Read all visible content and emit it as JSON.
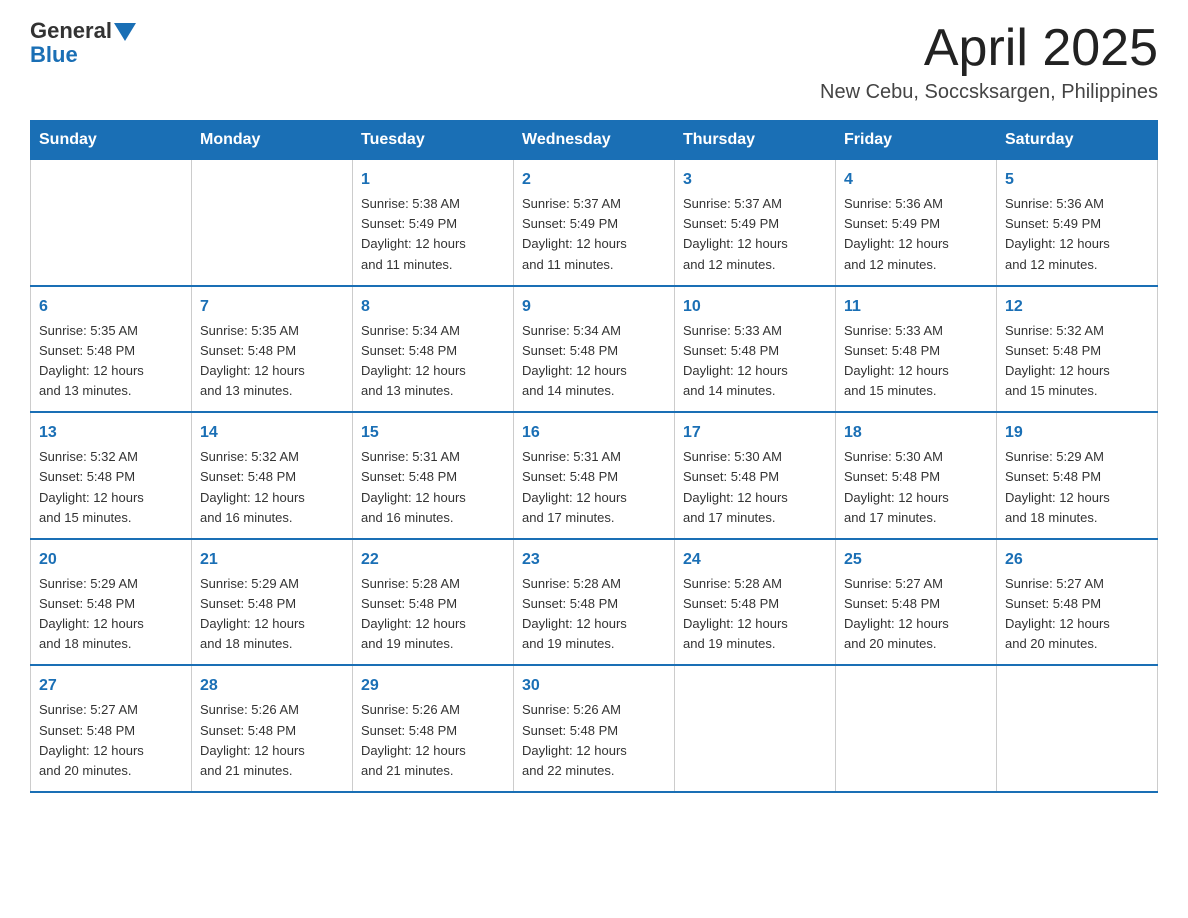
{
  "logo": {
    "general": "General",
    "blue": "Blue",
    "arrow": "▼"
  },
  "title": "April 2025",
  "subtitle": "New Cebu, Soccsksargen, Philippines",
  "days_header": [
    "Sunday",
    "Monday",
    "Tuesday",
    "Wednesday",
    "Thursday",
    "Friday",
    "Saturday"
  ],
  "weeks": [
    [
      {
        "day": "",
        "info": ""
      },
      {
        "day": "",
        "info": ""
      },
      {
        "day": "1",
        "info": "Sunrise: 5:38 AM\nSunset: 5:49 PM\nDaylight: 12 hours\nand 11 minutes."
      },
      {
        "day": "2",
        "info": "Sunrise: 5:37 AM\nSunset: 5:49 PM\nDaylight: 12 hours\nand 11 minutes."
      },
      {
        "day": "3",
        "info": "Sunrise: 5:37 AM\nSunset: 5:49 PM\nDaylight: 12 hours\nand 12 minutes."
      },
      {
        "day": "4",
        "info": "Sunrise: 5:36 AM\nSunset: 5:49 PM\nDaylight: 12 hours\nand 12 minutes."
      },
      {
        "day": "5",
        "info": "Sunrise: 5:36 AM\nSunset: 5:49 PM\nDaylight: 12 hours\nand 12 minutes."
      }
    ],
    [
      {
        "day": "6",
        "info": "Sunrise: 5:35 AM\nSunset: 5:48 PM\nDaylight: 12 hours\nand 13 minutes."
      },
      {
        "day": "7",
        "info": "Sunrise: 5:35 AM\nSunset: 5:48 PM\nDaylight: 12 hours\nand 13 minutes."
      },
      {
        "day": "8",
        "info": "Sunrise: 5:34 AM\nSunset: 5:48 PM\nDaylight: 12 hours\nand 13 minutes."
      },
      {
        "day": "9",
        "info": "Sunrise: 5:34 AM\nSunset: 5:48 PM\nDaylight: 12 hours\nand 14 minutes."
      },
      {
        "day": "10",
        "info": "Sunrise: 5:33 AM\nSunset: 5:48 PM\nDaylight: 12 hours\nand 14 minutes."
      },
      {
        "day": "11",
        "info": "Sunrise: 5:33 AM\nSunset: 5:48 PM\nDaylight: 12 hours\nand 15 minutes."
      },
      {
        "day": "12",
        "info": "Sunrise: 5:32 AM\nSunset: 5:48 PM\nDaylight: 12 hours\nand 15 minutes."
      }
    ],
    [
      {
        "day": "13",
        "info": "Sunrise: 5:32 AM\nSunset: 5:48 PM\nDaylight: 12 hours\nand 15 minutes."
      },
      {
        "day": "14",
        "info": "Sunrise: 5:32 AM\nSunset: 5:48 PM\nDaylight: 12 hours\nand 16 minutes."
      },
      {
        "day": "15",
        "info": "Sunrise: 5:31 AM\nSunset: 5:48 PM\nDaylight: 12 hours\nand 16 minutes."
      },
      {
        "day": "16",
        "info": "Sunrise: 5:31 AM\nSunset: 5:48 PM\nDaylight: 12 hours\nand 17 minutes."
      },
      {
        "day": "17",
        "info": "Sunrise: 5:30 AM\nSunset: 5:48 PM\nDaylight: 12 hours\nand 17 minutes."
      },
      {
        "day": "18",
        "info": "Sunrise: 5:30 AM\nSunset: 5:48 PM\nDaylight: 12 hours\nand 17 minutes."
      },
      {
        "day": "19",
        "info": "Sunrise: 5:29 AM\nSunset: 5:48 PM\nDaylight: 12 hours\nand 18 minutes."
      }
    ],
    [
      {
        "day": "20",
        "info": "Sunrise: 5:29 AM\nSunset: 5:48 PM\nDaylight: 12 hours\nand 18 minutes."
      },
      {
        "day": "21",
        "info": "Sunrise: 5:29 AM\nSunset: 5:48 PM\nDaylight: 12 hours\nand 18 minutes."
      },
      {
        "day": "22",
        "info": "Sunrise: 5:28 AM\nSunset: 5:48 PM\nDaylight: 12 hours\nand 19 minutes."
      },
      {
        "day": "23",
        "info": "Sunrise: 5:28 AM\nSunset: 5:48 PM\nDaylight: 12 hours\nand 19 minutes."
      },
      {
        "day": "24",
        "info": "Sunrise: 5:28 AM\nSunset: 5:48 PM\nDaylight: 12 hours\nand 19 minutes."
      },
      {
        "day": "25",
        "info": "Sunrise: 5:27 AM\nSunset: 5:48 PM\nDaylight: 12 hours\nand 20 minutes."
      },
      {
        "day": "26",
        "info": "Sunrise: 5:27 AM\nSunset: 5:48 PM\nDaylight: 12 hours\nand 20 minutes."
      }
    ],
    [
      {
        "day": "27",
        "info": "Sunrise: 5:27 AM\nSunset: 5:48 PM\nDaylight: 12 hours\nand 20 minutes."
      },
      {
        "day": "28",
        "info": "Sunrise: 5:26 AM\nSunset: 5:48 PM\nDaylight: 12 hours\nand 21 minutes."
      },
      {
        "day": "29",
        "info": "Sunrise: 5:26 AM\nSunset: 5:48 PM\nDaylight: 12 hours\nand 21 minutes."
      },
      {
        "day": "30",
        "info": "Sunrise: 5:26 AM\nSunset: 5:48 PM\nDaylight: 12 hours\nand 22 minutes."
      },
      {
        "day": "",
        "info": ""
      },
      {
        "day": "",
        "info": ""
      },
      {
        "day": "",
        "info": ""
      }
    ]
  ]
}
